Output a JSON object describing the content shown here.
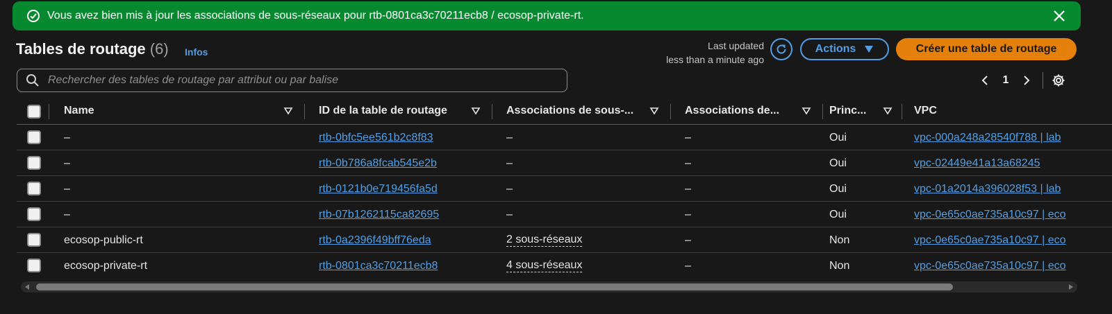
{
  "flash": {
    "message": "Vous avez bien mis à jour les associations de sous-réseaux pour rtb-0801ca3c70211ecb8 / ecosop-private-rt.",
    "icon": "check-circle-icon",
    "close_icon": "close-icon",
    "color": "#078a2f"
  },
  "header": {
    "title": "Tables de routage",
    "count": "(6)",
    "info": "Infos",
    "last_updated_label": "Last updated",
    "last_updated_value": "less than a minute ago",
    "actions_label": "Actions",
    "create_label": "Créer une table de routage",
    "accent": "#539fe5",
    "primary_color": "#e5810b"
  },
  "search": {
    "placeholder": "Rechercher des tables de routage par attribut ou par balise"
  },
  "pagination": {
    "page": "1"
  },
  "table": {
    "columns": [
      {
        "label": "Name"
      },
      {
        "label": "ID de la table de routage"
      },
      {
        "label": "Associations de sous-..."
      },
      {
        "label": "Associations de..."
      },
      {
        "label": "Princ..."
      },
      {
        "label": "VPC"
      }
    ],
    "rows": [
      {
        "name": "–",
        "id": "rtb-0bfc5ee561b2c8f83",
        "subnets": "–",
        "edge": "–",
        "main": "Oui",
        "vpc": "vpc-000a248a28540f788 | lab"
      },
      {
        "name": "–",
        "id": "rtb-0b786a8fcab545e2b",
        "subnets": "–",
        "edge": "–",
        "main": "Oui",
        "vpc": "vpc-02449e41a13a68245"
      },
      {
        "name": "–",
        "id": "rtb-0121b0e719456fa5d",
        "subnets": "–",
        "edge": "–",
        "main": "Oui",
        "vpc": "vpc-01a2014a396028f53 | lab"
      },
      {
        "name": "–",
        "id": "rtb-07b1262115ca82695",
        "subnets": "–",
        "edge": "–",
        "main": "Oui",
        "vpc": "vpc-0e65c0ae735a10c97 | eco"
      },
      {
        "name": "ecosop-public-rt",
        "id": "rtb-0a2396f49bff76eda",
        "subnets": "2 sous-réseaux",
        "edge": "–",
        "main": "Non",
        "vpc": "vpc-0e65c0ae735a10c97 | eco"
      },
      {
        "name": "ecosop-private-rt",
        "id": "rtb-0801ca3c70211ecb8",
        "subnets": "4 sous-réseaux",
        "edge": "–",
        "main": "Non",
        "vpc": "vpc-0e65c0ae735a10c97 | eco"
      }
    ]
  }
}
